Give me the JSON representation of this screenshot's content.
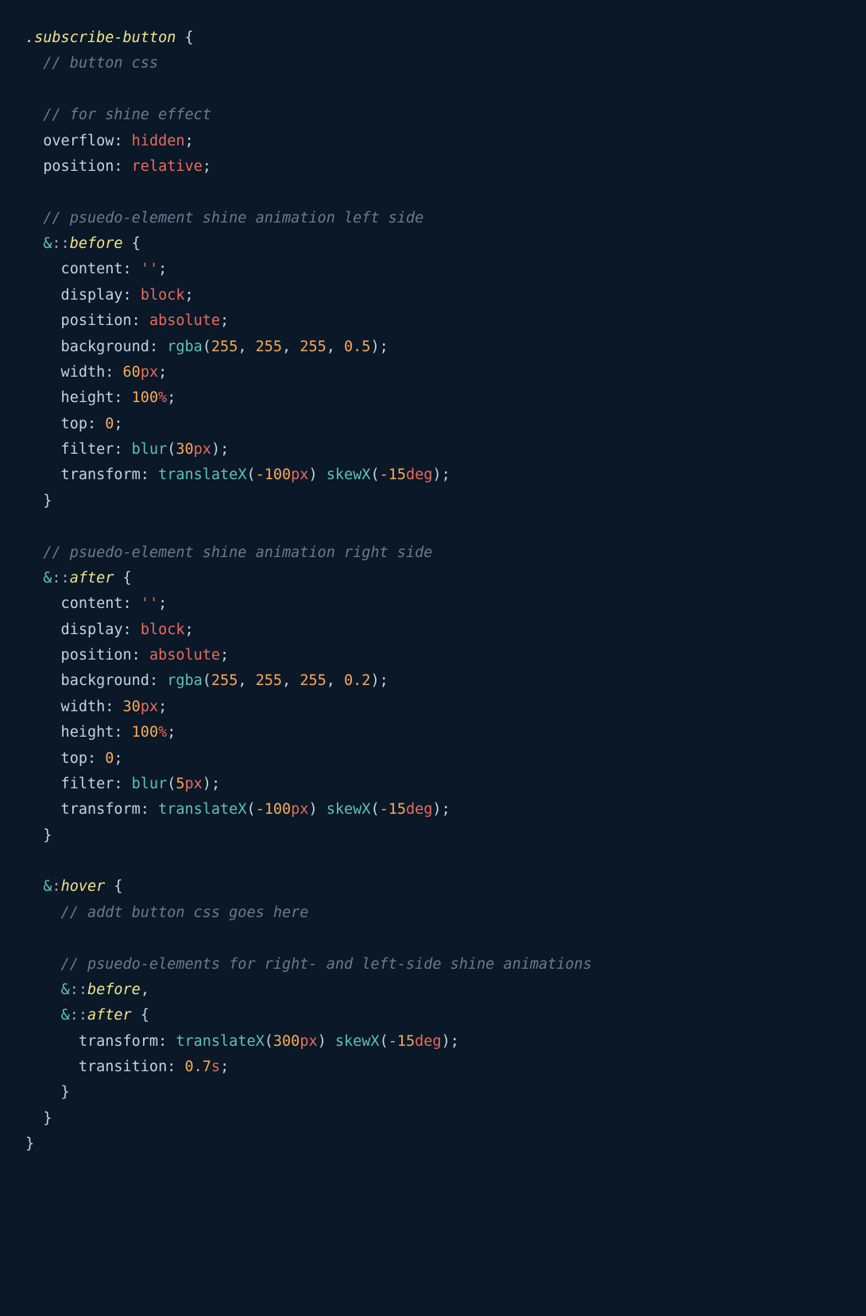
{
  "code": {
    "lines": [
      [
        {
          "cls": "selector",
          "t": ".subscribe-button"
        },
        {
          "cls": "punct",
          "t": " {"
        }
      ],
      [
        {
          "cls": "comment",
          "t": "  // button css"
        }
      ],
      [],
      [
        {
          "cls": "comment",
          "t": "  // for shine effect"
        }
      ],
      [
        {
          "cls": "property",
          "t": "  overflow"
        },
        {
          "cls": "punct",
          "t": ": "
        },
        {
          "cls": "value-keyword",
          "t": "hidden"
        },
        {
          "cls": "punct",
          "t": ";"
        }
      ],
      [
        {
          "cls": "property",
          "t": "  position"
        },
        {
          "cls": "punct",
          "t": ": "
        },
        {
          "cls": "value-keyword",
          "t": "relative"
        },
        {
          "cls": "punct",
          "t": ";"
        }
      ],
      [],
      [
        {
          "cls": "comment",
          "t": "  // psuedo-element shine animation left side"
        }
      ],
      [
        {
          "cls": "property",
          "t": "  "
        },
        {
          "cls": "amp",
          "t": "&"
        },
        {
          "cls": "pseudo-colon",
          "t": "::"
        },
        {
          "cls": "pseudo",
          "t": "before"
        },
        {
          "cls": "punct",
          "t": " {"
        }
      ],
      [
        {
          "cls": "property",
          "t": "    content"
        },
        {
          "cls": "punct",
          "t": ": "
        },
        {
          "cls": "string",
          "t": "''"
        },
        {
          "cls": "punct",
          "t": ";"
        }
      ],
      [
        {
          "cls": "property",
          "t": "    display"
        },
        {
          "cls": "punct",
          "t": ": "
        },
        {
          "cls": "value-keyword",
          "t": "block"
        },
        {
          "cls": "punct",
          "t": ";"
        }
      ],
      [
        {
          "cls": "property",
          "t": "    position"
        },
        {
          "cls": "punct",
          "t": ": "
        },
        {
          "cls": "value-keyword",
          "t": "absolute"
        },
        {
          "cls": "punct",
          "t": ";"
        }
      ],
      [
        {
          "cls": "property",
          "t": "    background"
        },
        {
          "cls": "punct",
          "t": ": "
        },
        {
          "cls": "func",
          "t": "rgba"
        },
        {
          "cls": "paren",
          "t": "("
        },
        {
          "cls": "number",
          "t": "255"
        },
        {
          "cls": "punct",
          "t": ", "
        },
        {
          "cls": "number",
          "t": "255"
        },
        {
          "cls": "punct",
          "t": ", "
        },
        {
          "cls": "number",
          "t": "255"
        },
        {
          "cls": "punct",
          "t": ", "
        },
        {
          "cls": "number",
          "t": "0.5"
        },
        {
          "cls": "paren",
          "t": ")"
        },
        {
          "cls": "punct",
          "t": ";"
        }
      ],
      [
        {
          "cls": "property",
          "t": "    width"
        },
        {
          "cls": "punct",
          "t": ": "
        },
        {
          "cls": "number",
          "t": "60"
        },
        {
          "cls": "unit",
          "t": "px"
        },
        {
          "cls": "punct",
          "t": ";"
        }
      ],
      [
        {
          "cls": "property",
          "t": "    height"
        },
        {
          "cls": "punct",
          "t": ": "
        },
        {
          "cls": "number",
          "t": "100"
        },
        {
          "cls": "unit",
          "t": "%"
        },
        {
          "cls": "punct",
          "t": ";"
        }
      ],
      [
        {
          "cls": "property",
          "t": "    top"
        },
        {
          "cls": "punct",
          "t": ": "
        },
        {
          "cls": "number",
          "t": "0"
        },
        {
          "cls": "punct",
          "t": ";"
        }
      ],
      [
        {
          "cls": "property",
          "t": "    filter"
        },
        {
          "cls": "punct",
          "t": ": "
        },
        {
          "cls": "func",
          "t": "blur"
        },
        {
          "cls": "paren",
          "t": "("
        },
        {
          "cls": "number",
          "t": "30"
        },
        {
          "cls": "unit",
          "t": "px"
        },
        {
          "cls": "paren",
          "t": ")"
        },
        {
          "cls": "punct",
          "t": ";"
        }
      ],
      [
        {
          "cls": "property",
          "t": "    transform"
        },
        {
          "cls": "punct",
          "t": ": "
        },
        {
          "cls": "func",
          "t": "translateX"
        },
        {
          "cls": "paren",
          "t": "("
        },
        {
          "cls": "number",
          "t": "-100"
        },
        {
          "cls": "unit",
          "t": "px"
        },
        {
          "cls": "paren",
          "t": ")"
        },
        {
          "cls": "punct",
          "t": " "
        },
        {
          "cls": "func",
          "t": "skewX"
        },
        {
          "cls": "paren",
          "t": "("
        },
        {
          "cls": "number",
          "t": "-15"
        },
        {
          "cls": "unit",
          "t": "deg"
        },
        {
          "cls": "paren",
          "t": ")"
        },
        {
          "cls": "punct",
          "t": ";"
        }
      ],
      [
        {
          "cls": "punct",
          "t": "  }"
        }
      ],
      [],
      [
        {
          "cls": "comment",
          "t": "  // psuedo-element shine animation right side"
        }
      ],
      [
        {
          "cls": "property",
          "t": "  "
        },
        {
          "cls": "amp",
          "t": "&"
        },
        {
          "cls": "pseudo-colon",
          "t": "::"
        },
        {
          "cls": "pseudo",
          "t": "after"
        },
        {
          "cls": "punct",
          "t": " {"
        }
      ],
      [
        {
          "cls": "property",
          "t": "    content"
        },
        {
          "cls": "punct",
          "t": ": "
        },
        {
          "cls": "string",
          "t": "''"
        },
        {
          "cls": "punct",
          "t": ";"
        }
      ],
      [
        {
          "cls": "property",
          "t": "    display"
        },
        {
          "cls": "punct",
          "t": ": "
        },
        {
          "cls": "value-keyword",
          "t": "block"
        },
        {
          "cls": "punct",
          "t": ";"
        }
      ],
      [
        {
          "cls": "property",
          "t": "    position"
        },
        {
          "cls": "punct",
          "t": ": "
        },
        {
          "cls": "value-keyword",
          "t": "absolute"
        },
        {
          "cls": "punct",
          "t": ";"
        }
      ],
      [
        {
          "cls": "property",
          "t": "    background"
        },
        {
          "cls": "punct",
          "t": ": "
        },
        {
          "cls": "func",
          "t": "rgba"
        },
        {
          "cls": "paren",
          "t": "("
        },
        {
          "cls": "number",
          "t": "255"
        },
        {
          "cls": "punct",
          "t": ", "
        },
        {
          "cls": "number",
          "t": "255"
        },
        {
          "cls": "punct",
          "t": ", "
        },
        {
          "cls": "number",
          "t": "255"
        },
        {
          "cls": "punct",
          "t": ", "
        },
        {
          "cls": "number",
          "t": "0.2"
        },
        {
          "cls": "paren",
          "t": ")"
        },
        {
          "cls": "punct",
          "t": ";"
        }
      ],
      [
        {
          "cls": "property",
          "t": "    width"
        },
        {
          "cls": "punct",
          "t": ": "
        },
        {
          "cls": "number",
          "t": "30"
        },
        {
          "cls": "unit",
          "t": "px"
        },
        {
          "cls": "punct",
          "t": ";"
        }
      ],
      [
        {
          "cls": "property",
          "t": "    height"
        },
        {
          "cls": "punct",
          "t": ": "
        },
        {
          "cls": "number",
          "t": "100"
        },
        {
          "cls": "unit",
          "t": "%"
        },
        {
          "cls": "punct",
          "t": ";"
        }
      ],
      [
        {
          "cls": "property",
          "t": "    top"
        },
        {
          "cls": "punct",
          "t": ": "
        },
        {
          "cls": "number",
          "t": "0"
        },
        {
          "cls": "punct",
          "t": ";"
        }
      ],
      [
        {
          "cls": "property",
          "t": "    filter"
        },
        {
          "cls": "punct",
          "t": ": "
        },
        {
          "cls": "func",
          "t": "blur"
        },
        {
          "cls": "paren",
          "t": "("
        },
        {
          "cls": "number",
          "t": "5"
        },
        {
          "cls": "unit",
          "t": "px"
        },
        {
          "cls": "paren",
          "t": ")"
        },
        {
          "cls": "punct",
          "t": ";"
        }
      ],
      [
        {
          "cls": "property",
          "t": "    transform"
        },
        {
          "cls": "punct",
          "t": ": "
        },
        {
          "cls": "func",
          "t": "translateX"
        },
        {
          "cls": "paren",
          "t": "("
        },
        {
          "cls": "number",
          "t": "-100"
        },
        {
          "cls": "unit",
          "t": "px"
        },
        {
          "cls": "paren",
          "t": ")"
        },
        {
          "cls": "punct",
          "t": " "
        },
        {
          "cls": "func",
          "t": "skewX"
        },
        {
          "cls": "paren",
          "t": "("
        },
        {
          "cls": "number",
          "t": "-15"
        },
        {
          "cls": "unit",
          "t": "deg"
        },
        {
          "cls": "paren",
          "t": ")"
        },
        {
          "cls": "punct",
          "t": ";"
        }
      ],
      [
        {
          "cls": "punct",
          "t": "  }"
        }
      ],
      [],
      [
        {
          "cls": "property",
          "t": "  "
        },
        {
          "cls": "amp",
          "t": "&"
        },
        {
          "cls": "pseudo-colon",
          "t": ":"
        },
        {
          "cls": "pseudo",
          "t": "hover"
        },
        {
          "cls": "punct",
          "t": " {"
        }
      ],
      [
        {
          "cls": "comment",
          "t": "    // addt button css goes here"
        }
      ],
      [],
      [
        {
          "cls": "comment",
          "t": "    // psuedo-elements for right- and left-side shine animations"
        }
      ],
      [
        {
          "cls": "property",
          "t": "    "
        },
        {
          "cls": "amp",
          "t": "&"
        },
        {
          "cls": "pseudo-colon",
          "t": "::"
        },
        {
          "cls": "pseudo",
          "t": "before"
        },
        {
          "cls": "punct",
          "t": ","
        }
      ],
      [
        {
          "cls": "property",
          "t": "    "
        },
        {
          "cls": "amp",
          "t": "&"
        },
        {
          "cls": "pseudo-colon",
          "t": "::"
        },
        {
          "cls": "pseudo",
          "t": "after"
        },
        {
          "cls": "punct",
          "t": " {"
        }
      ],
      [
        {
          "cls": "property",
          "t": "      transform"
        },
        {
          "cls": "punct",
          "t": ": "
        },
        {
          "cls": "func",
          "t": "translateX"
        },
        {
          "cls": "paren",
          "t": "("
        },
        {
          "cls": "number",
          "t": "300"
        },
        {
          "cls": "unit",
          "t": "px"
        },
        {
          "cls": "paren",
          "t": ")"
        },
        {
          "cls": "punct",
          "t": " "
        },
        {
          "cls": "func",
          "t": "skewX"
        },
        {
          "cls": "paren",
          "t": "("
        },
        {
          "cls": "number",
          "t": "-15"
        },
        {
          "cls": "unit",
          "t": "deg"
        },
        {
          "cls": "paren",
          "t": ")"
        },
        {
          "cls": "punct",
          "t": ";"
        }
      ],
      [
        {
          "cls": "property",
          "t": "      transition"
        },
        {
          "cls": "punct",
          "t": ": "
        },
        {
          "cls": "number",
          "t": "0.7"
        },
        {
          "cls": "unit",
          "t": "s"
        },
        {
          "cls": "punct",
          "t": ";"
        }
      ],
      [
        {
          "cls": "punct",
          "t": "    }"
        }
      ],
      [
        {
          "cls": "punct",
          "t": "  }"
        }
      ],
      [
        {
          "cls": "punct",
          "t": "}"
        }
      ]
    ]
  }
}
